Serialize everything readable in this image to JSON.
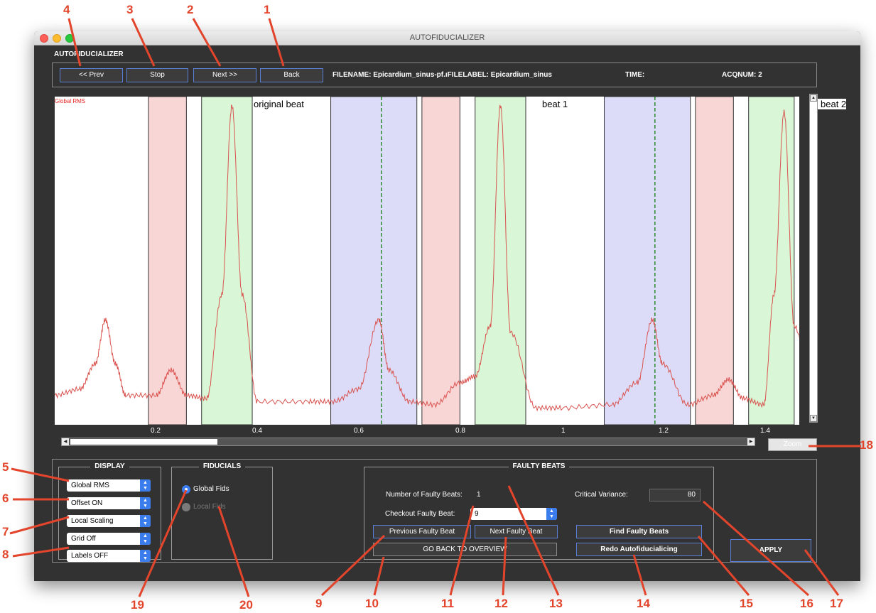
{
  "window": {
    "title": "AUTOFIDUCIALIZER",
    "app_title": "AUTOFIDUCIALIZER"
  },
  "toolbar": {
    "prev_label": "<< Prev",
    "stop_label": "Stop",
    "next_label": "Next >>",
    "back_label": "Back",
    "filename_text": "FILENAME: Epicardium_sinus-pf.ıFILELABEL: Epicardium_sinus",
    "time_text": "TIME:",
    "acqnum_text": "ACQNUM: 2"
  },
  "plot": {
    "signal_label": "Global RMS",
    "beat_labels": [
      "original beat",
      "beat 1",
      "beat 2"
    ],
    "x_ticks": [
      "0.2",
      "0.4",
      "0.6",
      "0.8",
      "1",
      "1.2",
      "1.4"
    ],
    "zoom_label": "Zoom"
  },
  "chart_data": {
    "type": "line",
    "series": [
      {
        "name": "Global RMS",
        "x": [
          0.0,
          0.05,
          0.08,
          0.1,
          0.12,
          0.14,
          0.2,
          0.23,
          0.26,
          0.3,
          0.33,
          0.35,
          0.37,
          0.4,
          0.5,
          0.55,
          0.6,
          0.64,
          0.66,
          0.7,
          0.75,
          0.8,
          0.83,
          0.86,
          0.88,
          0.9,
          0.95,
          1.0,
          1.1,
          1.15,
          1.18,
          1.2,
          1.25,
          1.3,
          1.33,
          1.36,
          1.4,
          1.42,
          1.44,
          1.46,
          1.5
        ],
        "y": [
          0.08,
          0.1,
          0.18,
          0.32,
          0.18,
          0.08,
          0.08,
          0.16,
          0.08,
          0.07,
          0.4,
          1.0,
          0.4,
          0.06,
          0.06,
          0.06,
          0.1,
          0.32,
          0.16,
          0.06,
          0.05,
          0.12,
          0.14,
          0.3,
          1.0,
          0.28,
          0.04,
          0.04,
          0.05,
          0.12,
          0.32,
          0.18,
          0.05,
          0.08,
          0.13,
          0.07,
          0.05,
          0.4,
          0.98,
          0.3,
          0.05
        ]
      }
    ],
    "regions": [
      {
        "kind": "red",
        "x0": 0.185,
        "x1": 0.26
      },
      {
        "kind": "green",
        "x0": 0.29,
        "x1": 0.39
      },
      {
        "kind": "blue",
        "x0": 0.545,
        "x1": 0.715
      },
      {
        "kind": "red",
        "x0": 0.725,
        "x1": 0.8
      },
      {
        "kind": "green",
        "x0": 0.83,
        "x1": 0.93
      },
      {
        "kind": "blue",
        "x0": 1.085,
        "x1": 1.255
      },
      {
        "kind": "red",
        "x0": 1.265,
        "x1": 1.34
      },
      {
        "kind": "green",
        "x0": 1.37,
        "x1": 1.46
      }
    ],
    "fiducial_lines": [
      0.645,
      1.185
    ],
    "xlim": [
      0.0,
      1.47
    ],
    "ylim": [
      0,
      1.02
    ],
    "grid": false
  },
  "display": {
    "title": "DISPLAY",
    "options": [
      {
        "name": "signal",
        "value": "Global RMS"
      },
      {
        "name": "offset",
        "value": "Offset ON"
      },
      {
        "name": "scaling",
        "value": "Local Scaling"
      },
      {
        "name": "grid",
        "value": "Grid Off"
      },
      {
        "name": "labels",
        "value": "Labels OFF"
      }
    ]
  },
  "fiducials": {
    "title": "FIDUCIALS",
    "global_label": "Global Fids",
    "local_label": "Local Fids"
  },
  "faulty": {
    "title": "FAULTY BEATS",
    "num_label": "Number of Faulty Beats:",
    "num_value": "1",
    "checkout_label": "Checkout Faulty Beat:",
    "checkout_value": "9",
    "crit_label": "Critical Variance:",
    "crit_value": "80",
    "prev_btn": "Previous Faulty Beat",
    "next_btn": "Next Faulty Beat",
    "overview_btn": "GO BACK TO OVERVIEW",
    "find_btn": "Find Faulty Beats",
    "redo_btn": "Redo Autofiducialicing"
  },
  "apply_label": "APPLY",
  "annotations": [
    "1",
    "2",
    "3",
    "4",
    "5",
    "6",
    "7",
    "8",
    "9",
    "10",
    "11",
    "12",
    "13",
    "14",
    "15",
    "16",
    "17",
    "18",
    "19",
    "20"
  ],
  "colors": {
    "annotation": "#e2452b",
    "window_bg": "#323232",
    "accent": "#3b7ded",
    "button_border": "#5b7fd6",
    "trace": "#d9534f",
    "region_red": "#f9d6d6",
    "region_green": "#d9f6d6",
    "region_blue": "#dcdcf8",
    "fiducial_line": "#2e8b2e"
  }
}
